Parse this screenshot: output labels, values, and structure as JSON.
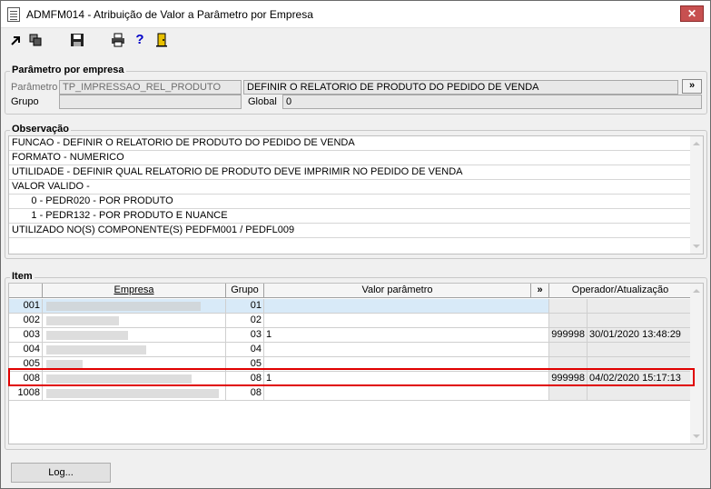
{
  "window": {
    "title": "ADMFM014 - Atribuição de Valor a Parâmetro por Empresa",
    "close_label": "✕"
  },
  "toolbar": {
    "icons": [
      "arrow-icon",
      "copy-icon",
      "save-icon",
      "print-icon",
      "help-icon",
      "exit-door-icon"
    ],
    "help_label": "?"
  },
  "parametro_section": {
    "title": "Parâmetro por empresa",
    "parametro_label": "Parâmetro",
    "parametro_value": "TP_IMPRESSAO_REL_PRODUTO",
    "descricao_value": "DEFINIR O RELATORIO DE PRODUTO DO PEDIDO DE VENDA",
    "more_label": "»",
    "grupo_label": "Grupo",
    "grupo_value": "",
    "global_label": "Global",
    "global_value": "0"
  },
  "observacao_section": {
    "title": "Observação",
    "lines": [
      "FUNCAO - DEFINIR O RELATORIO DE PRODUTO DO PEDIDO DE VENDA",
      "FORMATO - NUMERICO",
      "UTILIDADE - DEFINIR QUAL RELATORIO DE PRODUTO DEVE IMPRIMIR NO PEDIDO DE VENDA",
      "VALOR VALIDO -",
      "       0 - PEDR020 - POR PRODUTO",
      "       1 - PEDR132 - POR PRODUTO E NUANCE",
      "UTILIZADO NO(S) COMPONENTE(S) PEDFM001 / PEDFL009"
    ]
  },
  "item_section": {
    "title": "Item",
    "headers": {
      "empresa": "Empresa",
      "grupo": "Grupo",
      "valor": "Valor parâmetro",
      "more": "»",
      "operador": "Operador/Atualização"
    },
    "rows": [
      {
        "codigo": "001",
        "grupo": "01",
        "valor": "",
        "operador": "",
        "atualizacao": ""
      },
      {
        "codigo": "002",
        "grupo": "02",
        "valor": "",
        "operador": "",
        "atualizacao": ""
      },
      {
        "codigo": "003",
        "grupo": "03",
        "valor": "1",
        "operador": "999998",
        "atualizacao": "30/01/2020 13:48:29"
      },
      {
        "codigo": "004",
        "grupo": "04",
        "valor": "",
        "operador": "",
        "atualizacao": ""
      },
      {
        "codigo": "005",
        "grupo": "05",
        "valor": "",
        "operador": "",
        "atualizacao": ""
      },
      {
        "codigo": "008",
        "grupo": "08",
        "valor": "1",
        "operador": "999998",
        "atualizacao": "04/02/2020 15:17:13"
      },
      {
        "codigo": "1008",
        "grupo": "08",
        "valor": "",
        "operador": "",
        "atualizacao": ""
      }
    ]
  },
  "footer": {
    "log_label": "Log..."
  },
  "colors": {
    "highlight": "#e00000",
    "selected_row": "#d8eaf8"
  }
}
